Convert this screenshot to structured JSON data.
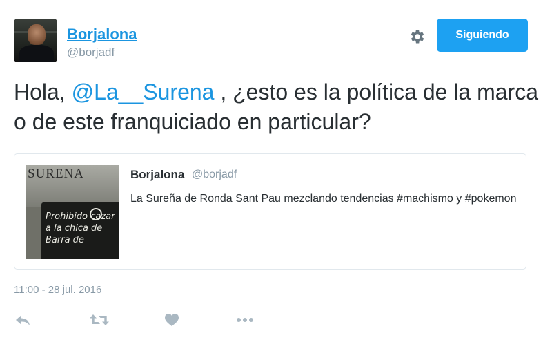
{
  "author": {
    "display_name": "Borjalona",
    "handle": "@borjadf"
  },
  "follow_button": {
    "label": "Siguiendo"
  },
  "tweet": {
    "text_before": "Hola, ",
    "mention": "@La__Surena",
    "text_after": " , ¿esto es la política de la marca o de este franquiciado en particular?"
  },
  "quoted_tweet": {
    "display_name": "Borjalona",
    "handle": "@borjadf",
    "text": "La Sureña de Ronda Sant Pau mezclando tendencias #machismo y #pokemon",
    "image": {
      "sign_text": "SURENA",
      "board_text": "Prohibido cazar a la chica de Barra de"
    }
  },
  "timestamp": "11:00 - 28 jul. 2016",
  "icons": {
    "settings": "gear-icon",
    "reply": "reply-icon",
    "retweet": "retweet-icon",
    "like": "heart-icon",
    "more": "more-icon"
  },
  "colors": {
    "accent": "#1da1f2",
    "link": "#1b95e0",
    "secondary_text": "#8899a6",
    "icon_gray": "#aab8c2"
  }
}
